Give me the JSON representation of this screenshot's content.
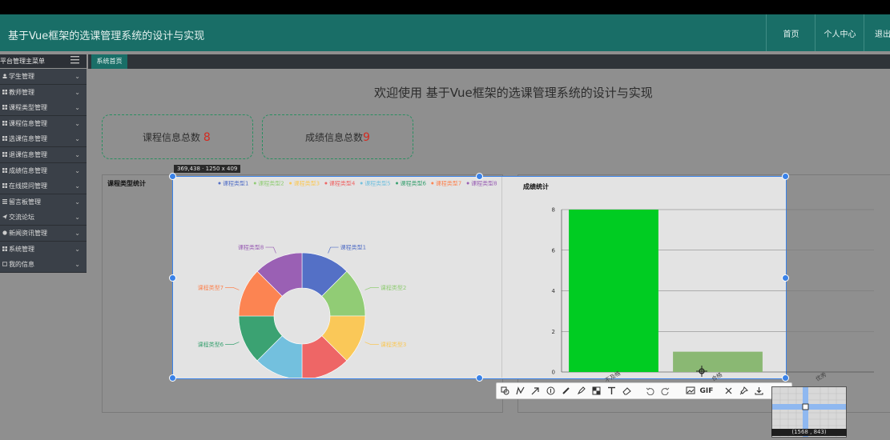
{
  "header": {
    "title": "基于Vue框架的选课管理系统的设计与实现",
    "nav": [
      "首页",
      "个人中心",
      "退出登"
    ]
  },
  "sidebar": {
    "heading": "平台管理主菜单",
    "items": [
      {
        "label": "学生管理",
        "icon": "user-icon"
      },
      {
        "label": "教师管理",
        "icon": "grid-icon"
      },
      {
        "label": "课程类型管理",
        "icon": "grid-icon"
      },
      {
        "label": "课程信息管理",
        "icon": "grid-icon"
      },
      {
        "label": "选课信息管理",
        "icon": "grid-icon"
      },
      {
        "label": "退课信息管理",
        "icon": "grid-icon"
      },
      {
        "label": "成绩信息管理",
        "icon": "grid-icon"
      },
      {
        "label": "在线提问管理",
        "icon": "grid-icon"
      },
      {
        "label": "留言板管理",
        "icon": "list-icon"
      },
      {
        "label": "交流论坛",
        "icon": "send-icon"
      },
      {
        "label": "新闻资讯管理",
        "icon": "circle-icon"
      },
      {
        "label": "系统管理",
        "icon": "grid-icon"
      },
      {
        "label": "我的信息",
        "icon": "card-icon"
      }
    ]
  },
  "tabs": {
    "home": "系统首页"
  },
  "main": {
    "welcome": "欢迎使用 基于Vue框架的选课管理系统的设计与实现",
    "cards": [
      {
        "label": "课程信息总数",
        "value": "8"
      },
      {
        "label": "成绩信息总数",
        "value": "9"
      }
    ],
    "panel_left_title": "课程类型统计",
    "panel_right_title": "成绩统计"
  },
  "capture": {
    "size_label": "369,438 · 1250 x 409",
    "mag_coords": "(1568 , 843)",
    "gif_label": "GIF"
  },
  "chart_data": [
    {
      "type": "pie",
      "legend_placement": "top",
      "labels": [
        "课程类型1",
        "课程类型2",
        "课程类型3",
        "课程类型4",
        "课程类型5",
        "课程类型6",
        "课程类型7",
        "课程类型8"
      ],
      "values": [
        1,
        1,
        1,
        1,
        1,
        1,
        1,
        1
      ],
      "colors": [
        "#5470c6",
        "#91cc75",
        "#fac858",
        "#ee6666",
        "#73c0de",
        "#3ba272",
        "#fc8452",
        "#9a60b4"
      ]
    },
    {
      "type": "bar",
      "categories": [
        "不及格",
        "合格",
        "优秀"
      ],
      "values": [
        8,
        1,
        0
      ],
      "ylim": [
        0,
        8
      ],
      "yticks": [
        0,
        2,
        4,
        6,
        8
      ],
      "colors": [
        "#00cc22",
        "#8ab873",
        "#8ab873"
      ]
    }
  ],
  "colors": {
    "header": "#196e67",
    "sidebar": "#3a4048",
    "selection": "#3a82e8",
    "accent_red": "#d42a20"
  }
}
